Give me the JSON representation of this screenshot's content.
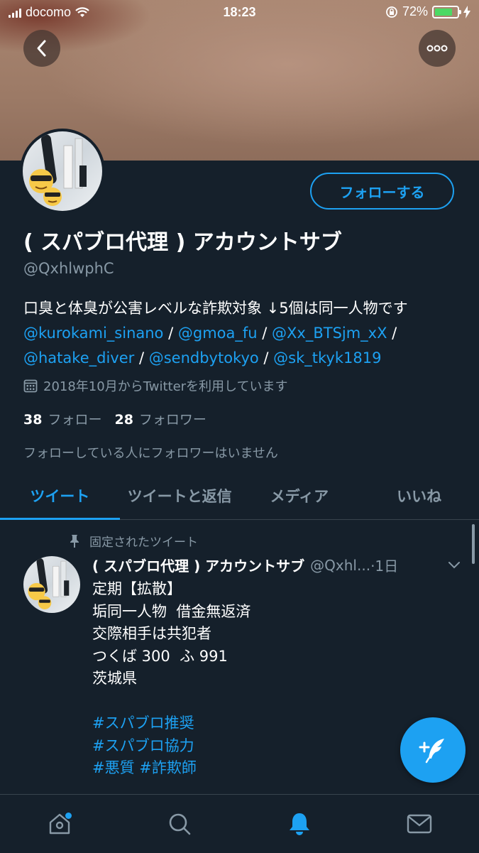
{
  "statusbar": {
    "carrier": "docomo",
    "time": "18:23",
    "battery_text": "72%",
    "battery_level": 0.72
  },
  "profile": {
    "follow_label": "フォローする",
    "name": "( スパブロ代理 ) アカウントサブ",
    "handle": "@QxhlwphC",
    "bio_text": "口臭と体臭が公害レベルな詐欺対象 ↓5個は同一人物です",
    "bio_links": [
      "@kurokami_sinano",
      "@gmoa_fu",
      "@Xx_BTSjm_xX",
      "@hatake_diver",
      "@sendbytokyo",
      "@sk_tkyk1819"
    ],
    "bio_separator": " / ",
    "joined": "2018年10月からTwitterを利用しています",
    "following_count": "38",
    "following_label": "フォロー",
    "followers_count": "28",
    "followers_label": "フォロワー",
    "no_known_followers": "フォローしている人にフォロワーはいません"
  },
  "tabs": [
    {
      "label": "ツイート",
      "active": true
    },
    {
      "label": "ツイートと返信",
      "active": false
    },
    {
      "label": "メディア",
      "active": false
    },
    {
      "label": "いいね",
      "active": false
    }
  ],
  "tweet": {
    "pinned_label": "固定されたツイート",
    "author_name": "( スパブロ代理 ) アカウントサブ",
    "author_handle": "@Qxhl...",
    "time": "·1日",
    "lines": [
      "定期【拡散】",
      "垢同一人物  借金無返済",
      "交際相手は共犯者",
      "つくば 300  ふ 991",
      "茨城県"
    ],
    "hashtag_lines": [
      "#スパブロ推奨",
      "#スパブロ協力",
      "#悪質 #詐欺師"
    ]
  },
  "colors": {
    "background": "#15202b",
    "accent": "#1da1f2",
    "secondary_text": "#8899a6",
    "battery_green": "#4cd964"
  },
  "icons": {
    "back": "chevron-left-icon",
    "more": "more-dots-icon",
    "calendar": "calendar-icon",
    "pin": "pin-icon",
    "chevron": "chevron-down-icon",
    "compose": "compose-tweet-icon",
    "home": "home-icon",
    "search": "search-icon",
    "notifications": "bell-icon",
    "messages": "mail-icon"
  }
}
